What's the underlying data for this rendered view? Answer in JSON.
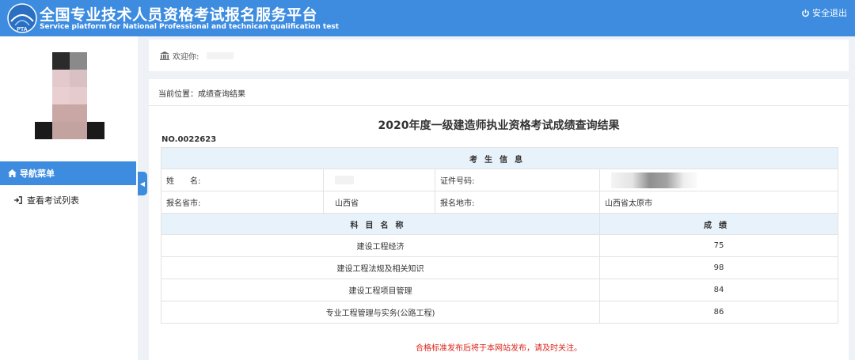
{
  "header": {
    "title_zh": "全国专业技术人员资格考试报名服务平台",
    "title_en": "Service platform for National Professional and technican qualification test",
    "logout_label": "安全退出",
    "brand_color": "#3d8ce0"
  },
  "sidebar": {
    "nav_header": "导航菜单",
    "items": [
      {
        "label": "查看考试列表",
        "icon": "sign-in-icon"
      }
    ]
  },
  "welcome": {
    "label": "欢迎你:"
  },
  "content": {
    "breadcrumb": "当前位置：成绩查询结果",
    "title": "2020年度一级建造师执业资格考试成绩查询结果",
    "cert_no": "NO.0022623",
    "candidate_section": "考生信息",
    "fields": {
      "name_label": "姓　　名:",
      "id_label": "证件号码:",
      "province_label": "报名省市:",
      "province_value": "山西省",
      "city_label": "报名地市:",
      "city_value": "山西省太原市"
    },
    "scores_header": {
      "subject": "科目名称",
      "score": "成绩"
    },
    "scores": [
      {
        "subject": "建设工程经济",
        "score": "75"
      },
      {
        "subject": "建设工程法规及相关知识",
        "score": "98"
      },
      {
        "subject": "建设工程项目管理",
        "score": "84"
      },
      {
        "subject": "专业工程管理与实务(公路工程)",
        "score": "86"
      }
    ],
    "notice": "合格标准发布后将于本网站发布，请及时关注。",
    "notice_color": "#d9251d"
  }
}
